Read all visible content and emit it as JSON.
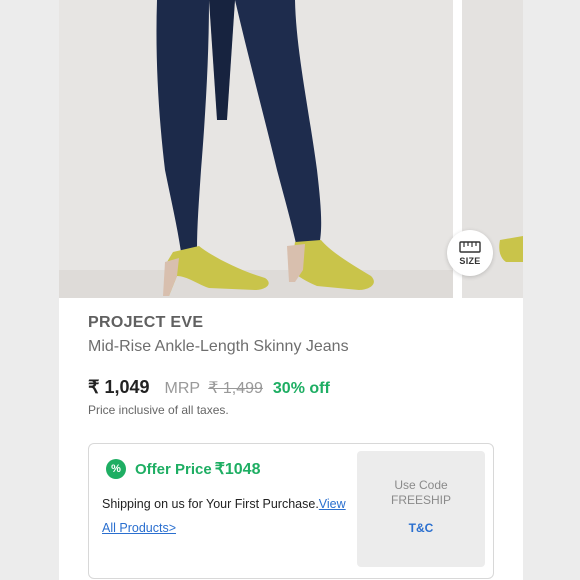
{
  "product": {
    "brand": "PROJECT EVE",
    "title": "Mid-Rise Ankle-Length Skinny Jeans",
    "size_label": "SIZE"
  },
  "pricing": {
    "price": "₹ 1,049",
    "mrp_label": "MRP",
    "mrp_value": "₹ 1,499",
    "discount": "30% off",
    "tax_note": "Price inclusive of all taxes."
  },
  "offer": {
    "badge": "%",
    "label": "Offer Price",
    "amount": "₹1048",
    "description": "Shipping on us for Your First Purchase.",
    "link_text": "View All Products>",
    "code_line1": "Use Code",
    "code_line2": "FREESHIP",
    "tnc": "T&C"
  },
  "colors": {
    "accent_green": "#1eae63",
    "link_blue": "#2a6fcf",
    "jeans": "#1c2a4a",
    "shoe": "#c9c44a"
  },
  "icons": {
    "size": "ruler-icon",
    "offer": "percent-badge-icon"
  }
}
